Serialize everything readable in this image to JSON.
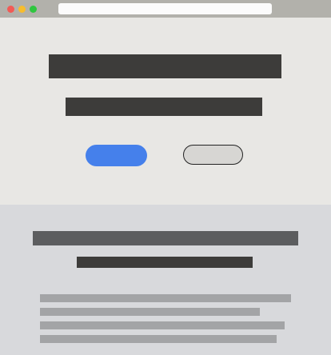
{
  "window": {
    "title": "",
    "url": ""
  },
  "hero": {
    "title": "",
    "subtitle": "",
    "primary_button_label": "",
    "secondary_button_label": ""
  },
  "section": {
    "title": "",
    "subtitle": "",
    "paragraph_lines": [
      "",
      "",
      "",
      ""
    ]
  },
  "colors": {
    "titlebar": "#b2b1ab",
    "close": "#f25a55",
    "minimize": "#f7bd2d",
    "maximize": "#2fc63f",
    "hero_background": "#e8e7e4",
    "section_background": "#d8d9dc",
    "primary_button": "#4580eb",
    "secondary_button": "#d7d6d3",
    "text_placeholder_dark": "#3d3c3a",
    "text_placeholder_mid": "#5c5d5f",
    "text_placeholder_light": "#a3a4a6"
  }
}
